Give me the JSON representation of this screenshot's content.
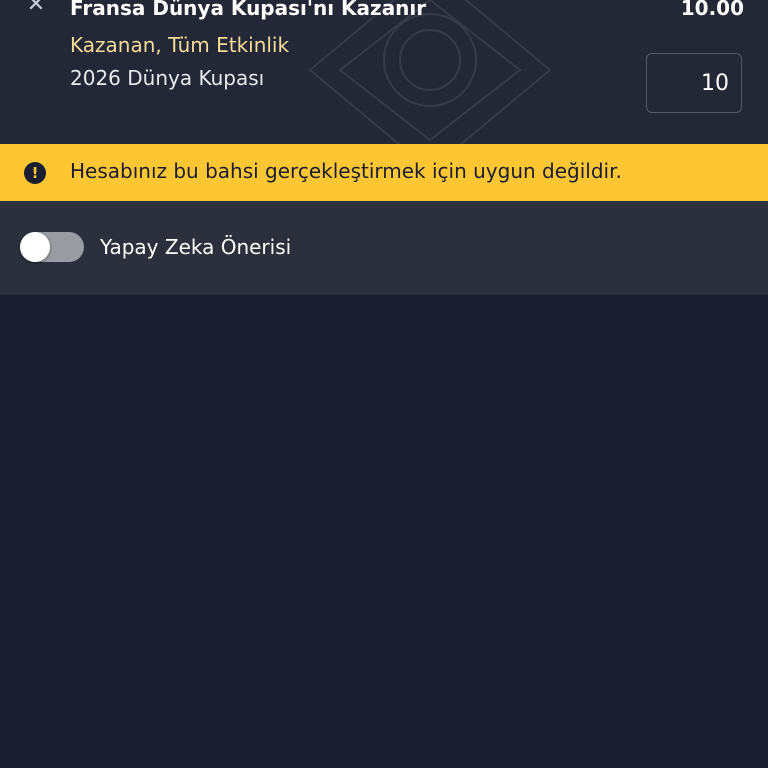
{
  "bet": {
    "close_icon": "close-icon",
    "title": "Fransa Dünya Kupası'nı Kazanır",
    "odds": "10.00",
    "market": "Kazanan, Tüm Etkinlik",
    "event": "2026 Dünya Kupası",
    "stake_value": "10"
  },
  "warning": {
    "icon": "exclamation-circle-icon",
    "text": "Hesabınız bu bahsi gerçekleştirmek için uygun değildir."
  },
  "ai_suggestion": {
    "label": "Yapay Zeka Önerisi",
    "enabled": false
  },
  "colors": {
    "background": "#1a1e2e",
    "card": "#242836",
    "market_text": "#f2dc9a",
    "warning_bg": "#fdc633",
    "row_bg": "#2c303d"
  }
}
